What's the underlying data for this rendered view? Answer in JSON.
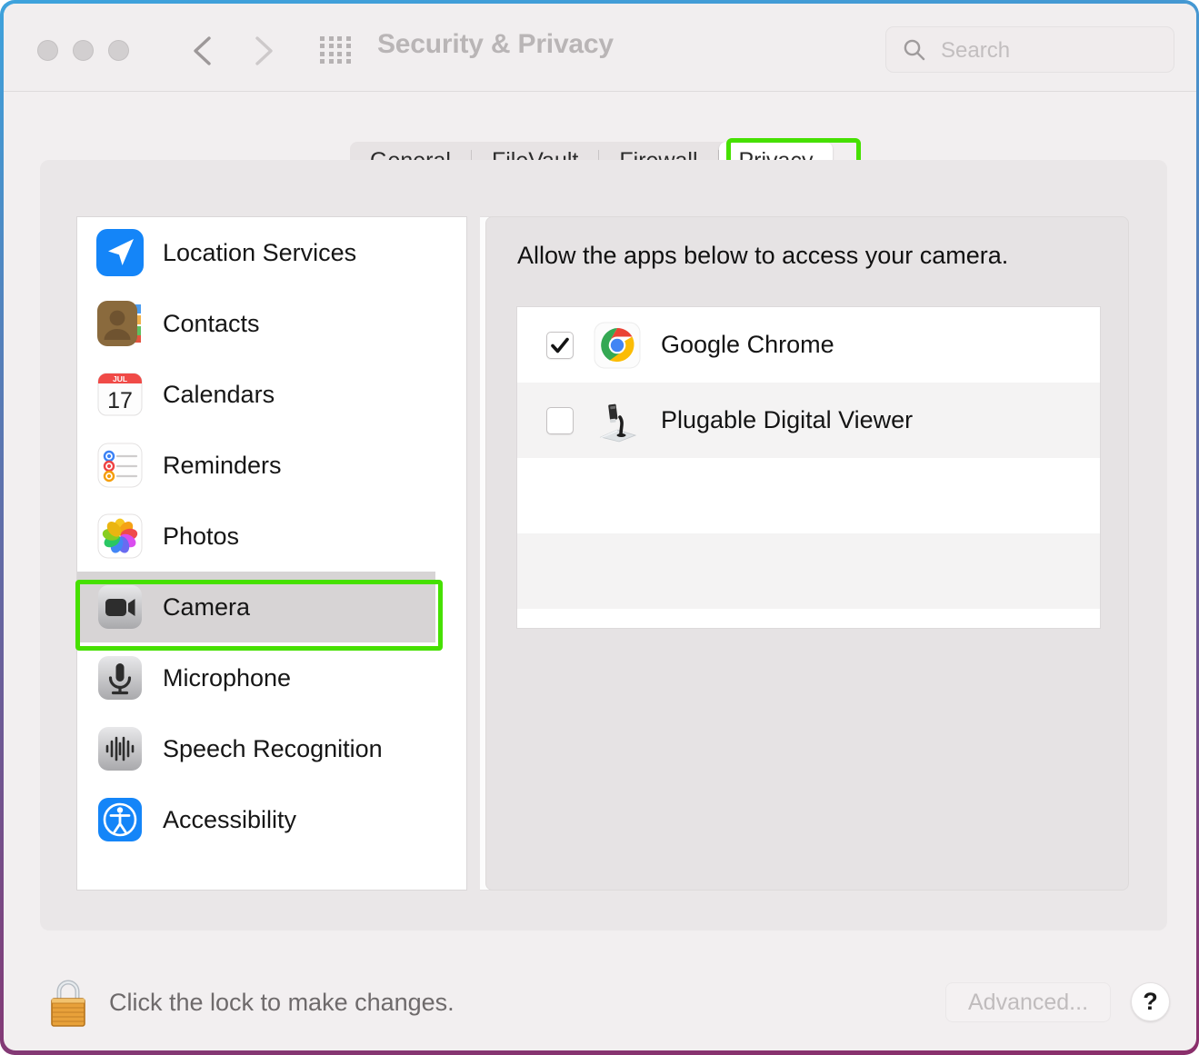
{
  "window": {
    "title": "Security & Privacy",
    "traffic_lights": [
      "close",
      "minimize",
      "maximize"
    ],
    "nav": {
      "back": "back-chevron",
      "forward": "forward-chevron",
      "show_all": "grid-icon"
    }
  },
  "search": {
    "placeholder": "Search",
    "value": "",
    "icon": "search-icon"
  },
  "tabs": [
    {
      "label": "General",
      "selected": false
    },
    {
      "label": "FileVault",
      "selected": false
    },
    {
      "label": "Firewall",
      "selected": false
    },
    {
      "label": "Privacy",
      "selected": true
    }
  ],
  "sidebar": {
    "items": [
      {
        "label": "Location Services",
        "icon": "location-services-icon",
        "selected": false
      },
      {
        "label": "Contacts",
        "icon": "contacts-icon",
        "selected": false
      },
      {
        "label": "Calendars",
        "icon": "calendars-icon",
        "selected": false
      },
      {
        "label": "Reminders",
        "icon": "reminders-icon",
        "selected": false
      },
      {
        "label": "Photos",
        "icon": "photos-icon",
        "selected": false
      },
      {
        "label": "Camera",
        "icon": "camera-icon",
        "selected": true
      },
      {
        "label": "Microphone",
        "icon": "microphone-icon",
        "selected": false
      },
      {
        "label": "Speech Recognition",
        "icon": "speech-recognition-icon",
        "selected": false
      },
      {
        "label": "Accessibility",
        "icon": "accessibility-icon",
        "selected": false
      }
    ],
    "calendar_icon": {
      "month": "JUL",
      "day": "17"
    }
  },
  "detail": {
    "heading": "Allow the apps below to access your camera.",
    "apps": [
      {
        "label": "Google Chrome",
        "icon": "google-chrome-icon",
        "checked": true
      },
      {
        "label": "Plugable Digital Viewer",
        "icon": "plugable-digital-viewer-icon",
        "checked": false
      }
    ]
  },
  "footer": {
    "lock_icon": "closed-lock-icon",
    "lock_text": "Click the lock to make changes.",
    "advanced_label": "Advanced...",
    "help_label": "?"
  },
  "annotations": {
    "color": "#46e000",
    "targets": [
      "privacy-tab",
      "camera-sidebar-item"
    ]
  }
}
